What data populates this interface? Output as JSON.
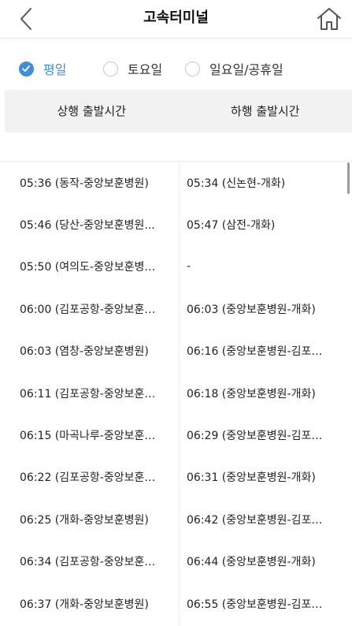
{
  "header": {
    "title": "고속터미널",
    "back_icon": "chevron-left-icon",
    "home_icon": "home-icon"
  },
  "day_tabs": [
    {
      "label": "평일",
      "selected": true
    },
    {
      "label": "토요일",
      "selected": false
    },
    {
      "label": "일요일/공휴일",
      "selected": false
    }
  ],
  "columns": {
    "up": "상행 출발시간",
    "down": "하행 출발시간"
  },
  "rows": [
    {
      "up": "05:36 (동작-중앙보훈병원)",
      "down": "05:34 (신논현-개화)"
    },
    {
      "up": "05:46 (당산-중앙보훈병원...",
      "down": "05:47 (삼전-개화)"
    },
    {
      "up": "05:50 (여의도-중앙보훈병…",
      "down": "-"
    },
    {
      "up": "06:00 (김포공항-중앙보훈…",
      "down": "06:03 (중앙보훈병원-개화)"
    },
    {
      "up": "06:03 (염창-중앙보훈병원)",
      "down": "06:16 (중앙보훈병원-김포…"
    },
    {
      "up": "06:11 (김포공항-중앙보훈…",
      "down": "06:18 (중앙보훈병원-개화)"
    },
    {
      "up": "06:15 (마곡나루-중앙보훈…",
      "down": "06:29 (중앙보훈병원-김포…"
    },
    {
      "up": "06:22 (김포공항-중앙보훈…",
      "down": "06:31 (중앙보훈병원-개화)"
    },
    {
      "up": "06:25 (개화-중앙보훈병원)",
      "down": "06:42 (중앙보훈병원-김포…"
    },
    {
      "up": "06:34 (김포공항-중앙보훈…",
      "down": "06:44 (중앙보훈병원-개화)"
    },
    {
      "up": "06:37 (개화-중앙보훈병원)",
      "down": "06:55 (중앙보훈병원-김포…"
    }
  ],
  "colors": {
    "accent": "#3f8fd6",
    "header_bg": "#f2f2f2"
  }
}
